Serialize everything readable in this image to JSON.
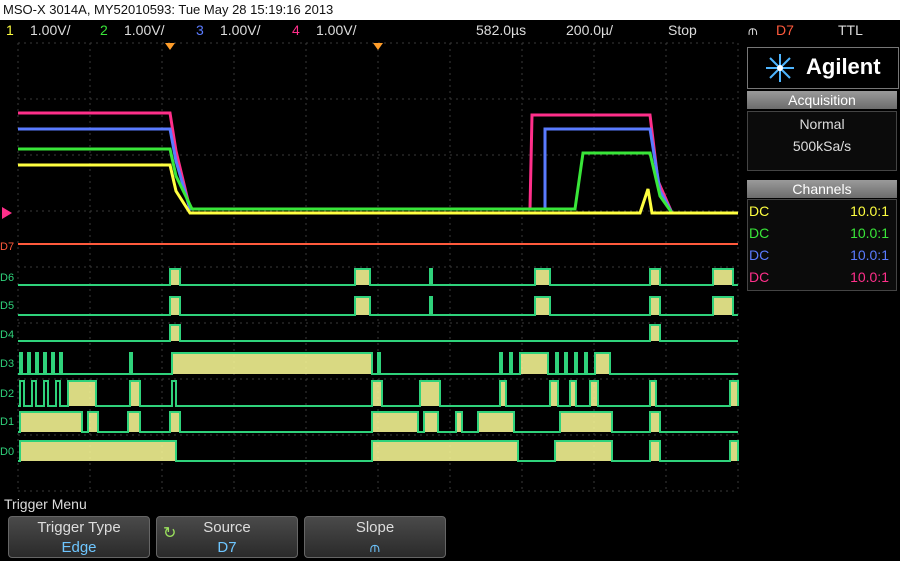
{
  "title_bar": "MSO-X 3014A, MY52010593: Tue May 28 15:19:16 2013",
  "status": {
    "ch1_num": "1",
    "ch1_scale": "1.00V/",
    "ch2_num": "2",
    "ch2_scale": "1.00V/",
    "ch3_num": "3",
    "ch3_scale": "1.00V/",
    "ch4_num": "4",
    "ch4_scale": "1.00V/",
    "delay": "582.0µs",
    "timebase": "200.0µ/",
    "run_state": "Stop",
    "trig_slope": "⫙",
    "trig_source": "D7",
    "trig_level": "TTL"
  },
  "digital_labels": [
    "D7",
    "D6",
    "D5",
    "D4",
    "D3",
    "D2",
    "D1",
    "D0"
  ],
  "logo": {
    "text": "Agilent",
    "icon": "agilent-spark-icon"
  },
  "acquisition": {
    "header": "Acquisition",
    "mode": "Normal",
    "rate": "500kSa/s"
  },
  "channels": {
    "header": "Channels",
    "rows": [
      {
        "coupling": "DC",
        "probe": "10.0:1",
        "color": "#ffff40"
      },
      {
        "coupling": "DC",
        "probe": "10.0:1",
        "color": "#39e639"
      },
      {
        "coupling": "DC",
        "probe": "10.0:1",
        "color": "#5a7bff"
      },
      {
        "coupling": "DC",
        "probe": "10.0:1",
        "color": "#ff2f8a"
      }
    ]
  },
  "menu": {
    "label": "Trigger Menu",
    "softkeys": [
      {
        "title": "Trigger Type",
        "value": "Edge"
      },
      {
        "title": "Source",
        "value": "D7"
      },
      {
        "title": "Slope",
        "value": "⫙"
      }
    ]
  },
  "colors": {
    "ch1": "#ffff40",
    "ch2": "#39e639",
    "ch3": "#5a7bff",
    "ch4": "#ff2f8a",
    "digital": "#2fd27b",
    "digital_fill": "#ffff99",
    "d7": "#ff5a3c"
  }
}
